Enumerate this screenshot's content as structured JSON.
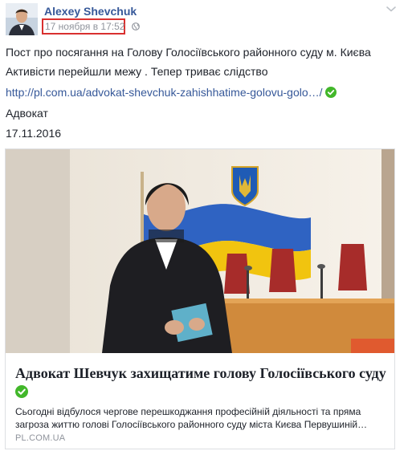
{
  "author": {
    "name": "Alexey Shevchuk"
  },
  "post": {
    "timestamp": "17 ноября в 17:52",
    "line1": "Пост про посягання на Голову Голосіївського районного суду м. Києва",
    "line2": "Активісти перейшли межу . Тепер триває слідство",
    "link": "http://pl.com.ua/advokat-shevchuk-zahishhatime-golovu-golo…/",
    "line4": "Адвокат",
    "line5": "17.11.2016"
  },
  "card": {
    "title": "Адвокат Шевчук захищатиме голову Голосіївського суду",
    "description": "Сьогодні відбулося чергове перешкоджання професійній діяльності та пряма загроза життю голові Голосіївського районного суду міста Києва Первушиній…",
    "domain": "PL.COM.UA"
  },
  "colors": {
    "link": "#365899",
    "highlight_box": "#d9302f",
    "verified": "#42b72a",
    "muted": "#90949c"
  },
  "icons": [
    "globe-icon",
    "chevron-down-icon",
    "verified-icon"
  ]
}
